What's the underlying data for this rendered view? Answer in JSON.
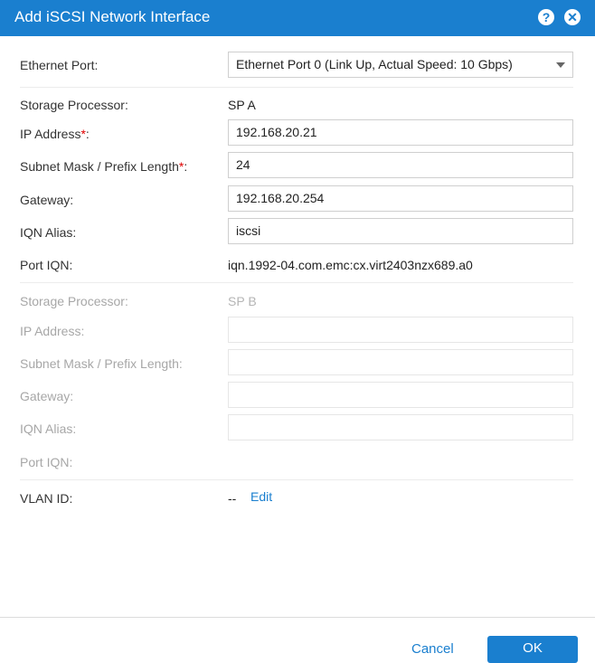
{
  "dialog": {
    "title": "Add iSCSI Network Interface",
    "help_icon": "help-icon",
    "close_icon": "close-icon"
  },
  "ethernet_port": {
    "label": "Ethernet Port:",
    "value": "Ethernet Port 0 (Link Up, Actual Speed: 10 Gbps)"
  },
  "sp_a": {
    "storage_processor_label": "Storage Processor:",
    "storage_processor_value": "SP A",
    "ip_label": "IP Address",
    "ip_value": "192.168.20.21",
    "subnet_label": "Subnet Mask / Prefix Length",
    "subnet_value": "24",
    "gateway_label": "Gateway:",
    "gateway_value": "192.168.20.254",
    "iqn_alias_label": "IQN Alias:",
    "iqn_alias_value": "iscsi",
    "port_iqn_label": "Port IQN:",
    "port_iqn_value": "iqn.1992-04.com.emc:cx.virt2403nzx689.a0"
  },
  "sp_b": {
    "storage_processor_label": "Storage Processor:",
    "storage_processor_value": "SP B",
    "ip_label": "IP Address:",
    "ip_value": "",
    "subnet_label": "Subnet Mask / Prefix Length:",
    "subnet_value": "",
    "gateway_label": "Gateway:",
    "gateway_value": "",
    "iqn_alias_label": "IQN Alias:",
    "iqn_alias_value": "",
    "port_iqn_label": "Port IQN:"
  },
  "vlan": {
    "label": "VLAN ID:",
    "value": "--",
    "edit_label": "Edit"
  },
  "required_marker": "*",
  "required_suffix": ":",
  "footer": {
    "cancel_label": "Cancel",
    "ok_label": "OK"
  },
  "colors": {
    "accent": "#1a7fcf",
    "required": "#e00000",
    "disabled_text": "#a7a7a7"
  }
}
